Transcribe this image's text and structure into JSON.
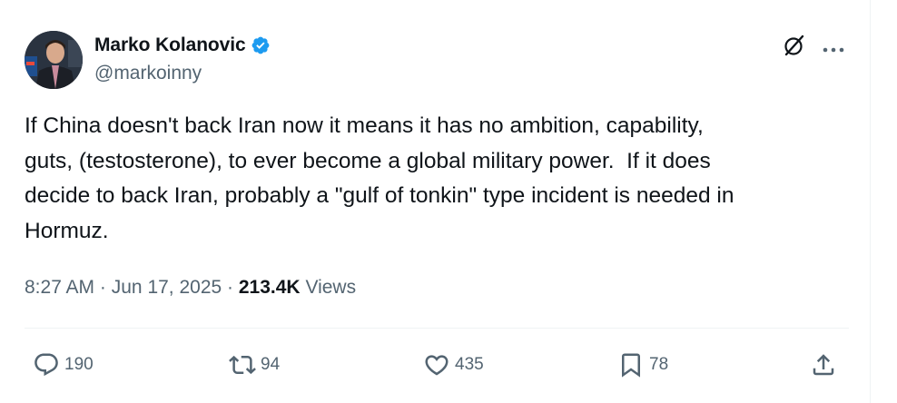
{
  "author": {
    "display_name": "Marko Kolanovic",
    "handle": "@markoinny",
    "verified": true
  },
  "tweet": {
    "text": "If China doesn't back Iran now it means it has no ambition, capability,\nguts, (testosterone), to ever become a global military power.  If it does\ndecide to back Iran, probably a \"gulf of tonkin\" type incident is needed in\nHormuz.",
    "time": "8:27 AM",
    "separator": "·",
    "date": "Jun 17, 2025",
    "views_count": "213.4K",
    "views_label": "Views"
  },
  "actions": {
    "replies": "190",
    "reposts": "94",
    "likes": "435",
    "bookmarks": "78"
  },
  "icons": {
    "verified": "verified-badge-icon",
    "grok": "grok-icon",
    "more": "more-icon",
    "reply": "reply-icon",
    "repost": "repost-icon",
    "like": "heart-icon",
    "bookmark": "bookmark-icon",
    "share": "share-icon"
  },
  "colors": {
    "text": "#0f1419",
    "secondary": "#536471",
    "verified": "#1d9bf0",
    "divider": "#eff3f4"
  }
}
